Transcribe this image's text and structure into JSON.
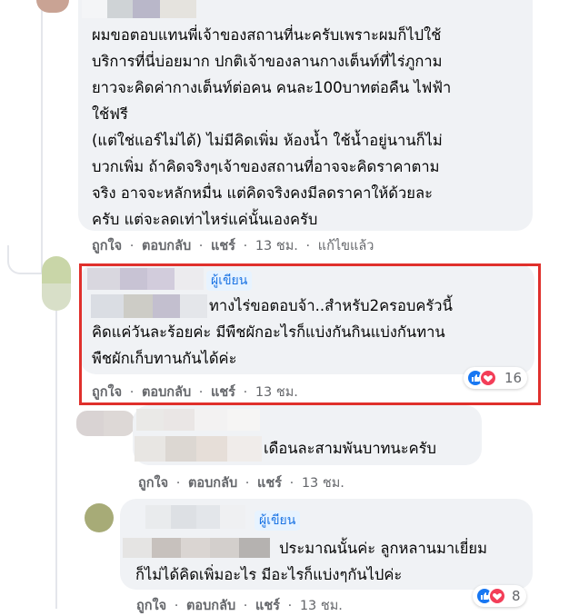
{
  "colors": {
    "bubble": "#f0f2f5",
    "highlight": "#e0302c",
    "badge_text": "#1b74e4",
    "action_text": "#65676b"
  },
  "comments": [
    {
      "text": "ผมขอตอบแทนพี่เจ้าของสถานที่นะครับเพราะผมก็ไปใช้\nบริการที่นี่บ่อยมาก ปกติเจ้าของลานกางเต็นท์ที่ไร่ภูกาม\nยาวจะคิดค่ากางเต็นท์ต่อคน คนละ100บาทต่อคืน ไฟฟ้า\nใช้ฟรี\n(แต่ใช่แอร์ไม่ได้) ไม่มีคิดเพิ่ม ห้องน้ำ ใช้น้ำอยู่นานก็ไม่\nบวกเพิ่ม ถ้าคิดจริงๆเจ้าของสถานที่อาจจะคิดราคาตาม\nจริง อาจจะหลักหมื่น แต่คิดจริงคงมีลดราคาให้ด้วยละ\nครับ แต่จะลดเท่าไหร่แค่นั้นเองครับ",
      "like": "ถูกใจ",
      "reply": "ตอบกลับ",
      "share": "แชร์",
      "time": "13 ชม.",
      "edited": "แก้ไขแล้ว"
    },
    {
      "badge": "ผู้เขียน",
      "first_line": "ทางไร่ขอตอบจ้า..สำหรับ2ครอบครัวนี้",
      "text": "คิดแค่วันละร้อยค่ะ มีพืชผักอะไรก็แบ่งกันกินแบ่งกันทาน\nพืชผักเก็บทานกันได้ค่ะ",
      "reaction_count": "16",
      "like": "ถูกใจ",
      "reply": "ตอบกลับ",
      "share": "แชร์",
      "time": "13 ชม."
    },
    {
      "text": "เดือนละสามพันบาทนะครับ",
      "like": "ถูกใจ",
      "reply": "ตอบกลับ",
      "share": "แชร์",
      "time": "13 ชม."
    },
    {
      "badge": "ผู้เขียน",
      "first_line": "ประมาณนั้นค่ะ ลูกหลานมาเยี่ยม",
      "text": "ก็ไม่ได้คิดเพิ่มอะไร มีอะไรก็แบ่งๆกันไปค่ะ",
      "reaction_count": "8",
      "like": "ถูกใจ",
      "reply": "ตอบกลับ",
      "share": "แชร์",
      "time": "13 ชม."
    }
  ],
  "separator": "·"
}
